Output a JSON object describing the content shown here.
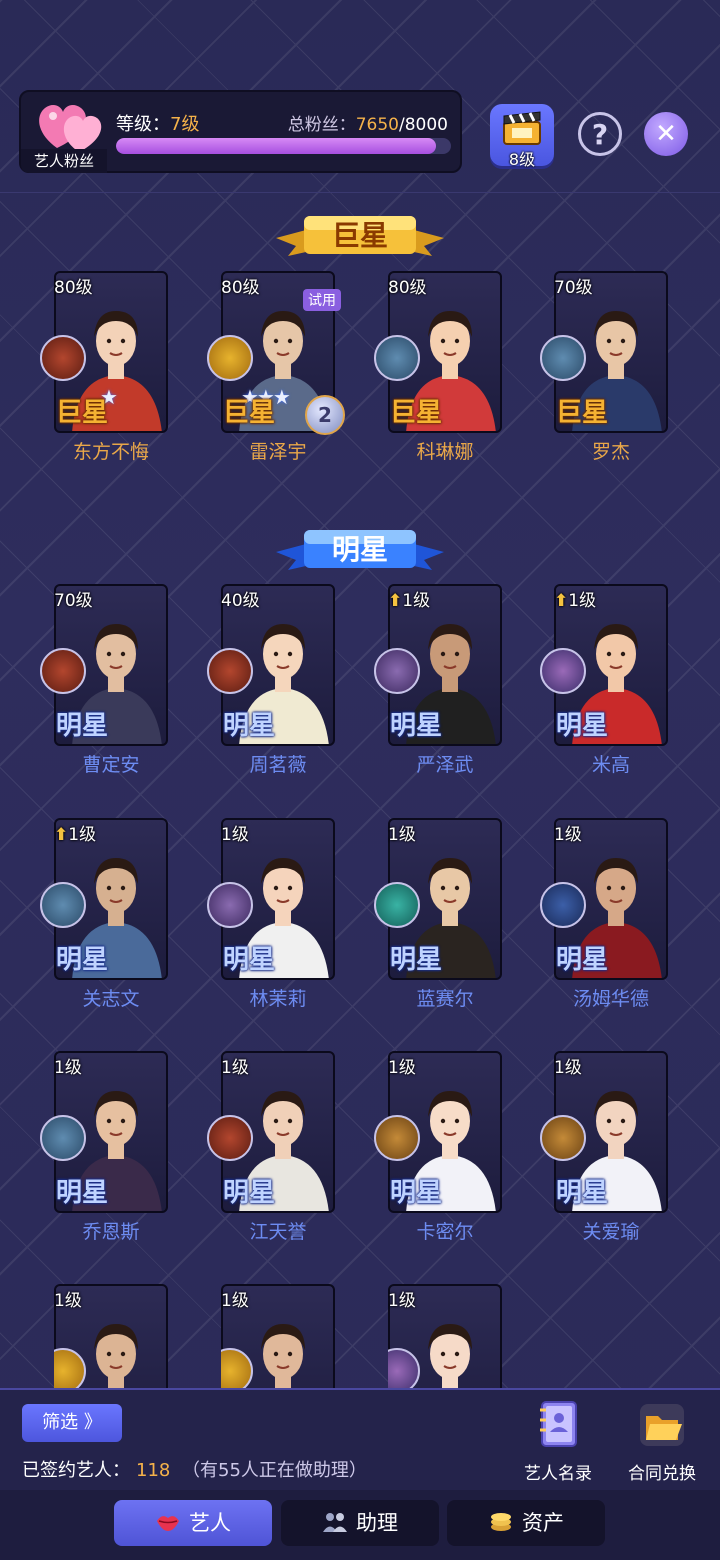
{
  "header": {
    "fan_tag": "艺人粉丝",
    "level_label": "等级：",
    "level_value": "7级",
    "fans_label": "总粉丝：",
    "fans_value": "7650",
    "fans_max": "/8000",
    "fans_progress": 0.956,
    "studio_level": "8级"
  },
  "sections": {
    "superstar_title": "巨星",
    "star_title": "明星"
  },
  "superstars": [
    {
      "level": "80级",
      "rank": "巨星",
      "name": "东方不悔",
      "badge": "silhouette-icon",
      "stars": "★"
    },
    {
      "level": "80级",
      "rank": "巨星",
      "name": "雷泽宇",
      "badge": "soldier-icon",
      "stars": "★★★",
      "trial": "试用"
    },
    {
      "level": "80级",
      "rank": "巨星",
      "name": "科琳娜",
      "badge": "ufo-icon"
    },
    {
      "level": "70级",
      "rank": "巨星",
      "name": "罗杰",
      "badge": "ufo-icon"
    }
  ],
  "stars": [
    {
      "level": "70级",
      "rank": "明星",
      "name": "曹定安",
      "badge": "silhouette-icon"
    },
    {
      "level": "40级",
      "rank": "明星",
      "name": "周茗薇",
      "badge": "silhouette-icon"
    },
    {
      "level": "1级",
      "rank": "明星",
      "name": "严泽武",
      "badge": "vortex-icon",
      "up": true
    },
    {
      "level": "1级",
      "rank": "明星",
      "name": "米高",
      "badge": "sunset-icon",
      "up": true
    },
    {
      "level": "1级",
      "rank": "明星",
      "name": "关志文",
      "badge": "ufo-icon",
      "up": true
    },
    {
      "level": "1级",
      "rank": "明星",
      "name": "林茉莉",
      "badge": "vortex-icon"
    },
    {
      "level": "1级",
      "rank": "明星",
      "name": "蓝赛尔",
      "badge": "dancer-icon"
    },
    {
      "level": "1级",
      "rank": "明星",
      "name": "汤姆华德",
      "badge": "ship-icon"
    },
    {
      "level": "1级",
      "rank": "明星",
      "name": "乔恩斯",
      "badge": "ufo-icon"
    },
    {
      "level": "1级",
      "rank": "明星",
      "name": "江天誉",
      "badge": "silhouette-icon"
    },
    {
      "level": "1级",
      "rank": "明星",
      "name": "卡密尔",
      "badge": "couple-icon"
    },
    {
      "level": "1级",
      "rank": "明星",
      "name": "关爱瑜",
      "badge": "couple-icon"
    },
    {
      "level": "1级",
      "rank": "",
      "name": "",
      "badge": "soldier-icon"
    },
    {
      "level": "1级",
      "rank": "",
      "name": "",
      "badge": "soldier-icon"
    },
    {
      "level": "1级",
      "rank": "",
      "name": "",
      "badge": "sunset-icon"
    }
  ],
  "bottom": {
    "filter_label": "筛选 》",
    "signed_label": "已签约艺人：",
    "signed_count": "118",
    "assist_note": "（有55人正在做助理）",
    "roster_label": "艺人名录",
    "contract_label": "合同兑换"
  },
  "tabs": [
    {
      "label": "艺人",
      "icon": "lips-icon"
    },
    {
      "label": "助理",
      "icon": "assistant-icon"
    },
    {
      "label": "资产",
      "icon": "coins-icon"
    }
  ],
  "colors": {
    "background": "#2a2a57",
    "gold": "#f5b24a",
    "star_name": "#6d8cf2",
    "superstar_name": "#e9a749",
    "accent_blue": "#5a63e8",
    "progress": "#b65fe8"
  }
}
